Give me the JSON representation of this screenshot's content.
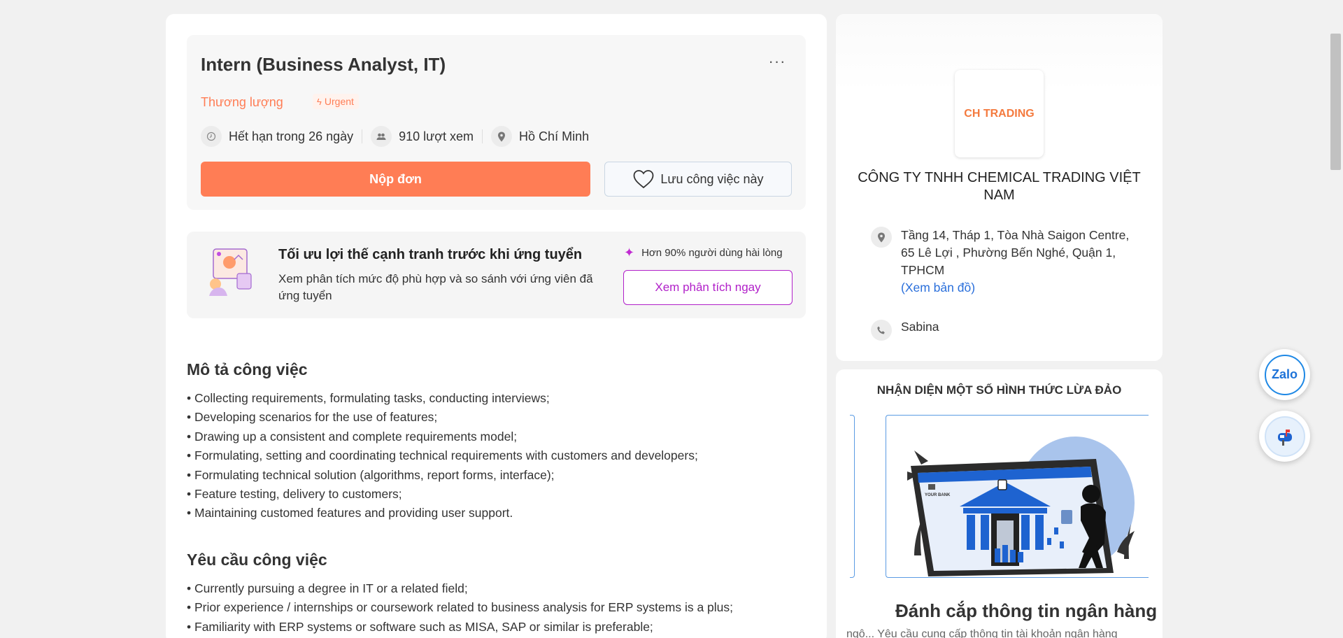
{
  "job": {
    "title": "Intern (Business Analyst, IT)",
    "salary": "Thương lượng",
    "urgent_badge": "Urgent",
    "deadline": "Hết hạn trong 26 ngày",
    "views": "910 lượt xem",
    "location": "Hồ Chí Minh",
    "apply_label": "Nộp đơn",
    "save_label": "Lưu công việc này",
    "more_label": "···"
  },
  "promo": {
    "title": "Tối ưu lợi thế cạnh tranh trước khi ứng tuyển",
    "description": "Xem phân tích mức độ phù hợp và so sánh với ứng viên đã ứng tuyển",
    "rating": "Hơn 90% người dùng hài lòng",
    "cta": "Xem phân tích ngay"
  },
  "description": {
    "title": "Mô tả công việc",
    "items": [
      "Collecting requirements, formulating tasks, conducting interviews;",
      "Developing scenarios for the use of features;",
      "Drawing up a consistent and complete requirements model;",
      "Formulating, setting and coordinating technical requirements with customers and developers;",
      "Formulating technical solution (algorithms, report forms, interface);",
      "Feature testing, delivery to customers;",
      "Maintaining customed features and providing user support."
    ]
  },
  "requirements": {
    "title": "Yêu cầu công việc",
    "items": [
      "Currently pursuing a degree in IT or a related field;",
      "Prior experience / internships or coursework related to business analysis for ERP systems is a plus;",
      "Familiarity with ERP systems or software such as MISA, SAP or similar is preferable;"
    ]
  },
  "company": {
    "logo_text": "CH TRADING",
    "name": "CÔNG TY TNHH CHEMICAL TRADING VIỆT NAM",
    "address": "Tầng 14, Tháp 1, Tòa Nhà Saigon Centre, 65 Lê Lợi , Phường Bến Nghé, Quận 1, TPHCM",
    "map_link": "(Xem bản đồ)",
    "contact": "Sabina"
  },
  "fraud": {
    "title": "NHẬN DIỆN MỘT SỐ HÌNH THỨC LỪA ĐẢO",
    "slide_caption": "Đánh cắp thông tin ngân hàng",
    "slide_sub": "ngô... Yêu cầu cung cấp thông tin tài khoản ngân hàng",
    "bank_label": "YOUR BANK"
  },
  "floating": {
    "zalo_label": "Zalo"
  },
  "colors": {
    "accent": "#ff7d55",
    "promo_accent": "#b120c9",
    "link": "#2a6fdb"
  }
}
